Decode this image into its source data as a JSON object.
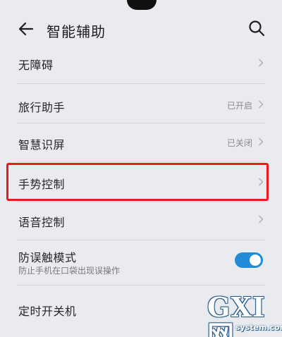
{
  "header": {
    "title": "智能辅助",
    "back_icon": "arrow-left-icon",
    "search_icon": "search-icon"
  },
  "items": [
    {
      "label": "无障碍",
      "value": ""
    },
    {
      "label": "旅行助手",
      "value": "已开启"
    },
    {
      "label": "智慧识屏",
      "value": "已关闭"
    },
    {
      "label": "手势控制",
      "value": ""
    },
    {
      "label": "语音控制",
      "value": ""
    },
    {
      "label": "防误触模式",
      "sub": "防止手机在口袋出现误操作",
      "toggle_on": true
    },
    {
      "label": "定时开关机",
      "value": ""
    }
  ],
  "colors": {
    "background": "#e9ebef",
    "toggle_on": "#1f8bd9",
    "highlight": "#f0161b"
  },
  "watermark": {
    "logo": "GXI网",
    "site": "system.com"
  }
}
